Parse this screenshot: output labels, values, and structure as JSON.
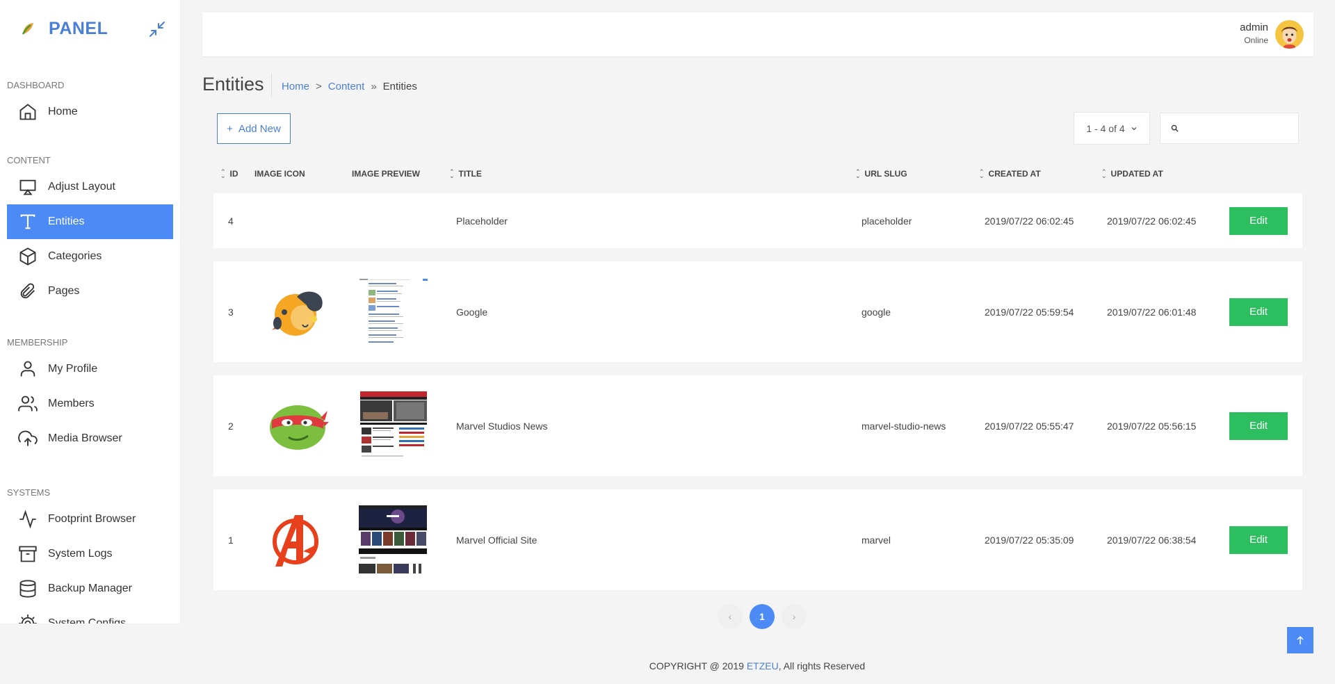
{
  "brand": {
    "name": "PANEL"
  },
  "sidebar": {
    "sections": [
      {
        "label": "DASHBOARD",
        "items": [
          {
            "label": "Home",
            "icon": "home-icon"
          }
        ]
      },
      {
        "label": "CONTENT",
        "items": [
          {
            "label": "Adjust Layout",
            "icon": "monitor-icon"
          },
          {
            "label": "Entities",
            "icon": "type-icon",
            "active": true
          },
          {
            "label": "Categories",
            "icon": "box-icon"
          },
          {
            "label": "Pages",
            "icon": "paperclip-icon"
          }
        ]
      },
      {
        "label": "MEMBERSHIP",
        "items": [
          {
            "label": "My Profile",
            "icon": "user-icon"
          },
          {
            "label": "Members",
            "icon": "users-icon"
          },
          {
            "label": "Media Browser",
            "icon": "upload-cloud-icon"
          }
        ]
      },
      {
        "label": "SYSTEMS",
        "items": [
          {
            "label": "Footprint Browser",
            "icon": "activity-icon"
          },
          {
            "label": "System Logs",
            "icon": "archive-icon"
          },
          {
            "label": "Backup Manager",
            "icon": "database-icon"
          },
          {
            "label": "System Configs",
            "icon": "settings-icon"
          }
        ]
      }
    ]
  },
  "header": {
    "user_name": "admin",
    "user_status": "Online"
  },
  "page": {
    "title": "Entities",
    "breadcrumb": {
      "home": "Home",
      "content": "Content",
      "current": "Entities",
      "sep1": ">",
      "sep2": "»"
    }
  },
  "toolbar": {
    "add_label": "Add New",
    "range_label": "1 - 4 of 4",
    "search_placeholder": ""
  },
  "table": {
    "columns": {
      "id": "ID",
      "image_icon": "IMAGE ICON",
      "image_preview": "IMAGE PREVIEW",
      "title": "TITLE",
      "url_slug": "URL SLUG",
      "created_at": "CREATED AT",
      "updated_at": "UPDATED AT"
    },
    "rows": [
      {
        "id": "4",
        "title": "Placeholder",
        "slug": "placeholder",
        "created": "2019/07/22 06:02:45",
        "updated": "2019/07/22 06:02:45",
        "edit": "Edit"
      },
      {
        "id": "3",
        "title": "Google",
        "slug": "google",
        "created": "2019/07/22 05:59:54",
        "updated": "2019/07/22 06:01:48",
        "edit": "Edit"
      },
      {
        "id": "2",
        "title": "Marvel Studios News",
        "slug": "marvel-studio-news",
        "created": "2019/07/22 05:55:47",
        "updated": "2019/07/22 05:56:15",
        "edit": "Edit"
      },
      {
        "id": "1",
        "title": "Marvel Official Site",
        "slug": "marvel",
        "created": "2019/07/22 05:35:09",
        "updated": "2019/07/22 06:38:54",
        "edit": "Edit"
      }
    ]
  },
  "pagination": {
    "prev": "‹",
    "current": "1",
    "next": "›"
  },
  "footer": {
    "prefix": "COPYRIGHT @ 2019",
    "brand": "ETZEU",
    "suffix": ", All rights Reserved"
  },
  "colors": {
    "accent": "#4c8af5",
    "link": "#4a7fd6",
    "edit": "#2dbe60"
  }
}
